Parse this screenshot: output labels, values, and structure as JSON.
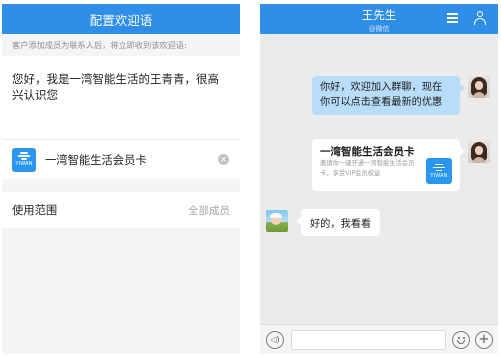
{
  "left_screen": {
    "title": "配置欢迎语",
    "hint": "客户添加成员为联系人后，将立即收到该欢迎语:",
    "message": "您好，我是一湾智能生活的王青青，很高兴认识您",
    "attachment": {
      "logo_text": "YIWAN",
      "name": "一湾智能生活会员卡",
      "icon": "clear-icon"
    },
    "scope": {
      "label": "使用范围",
      "value": "全部成员"
    }
  },
  "right_screen": {
    "title": "王先生",
    "subtitle": "@微信",
    "header_icons": [
      "menu-icon",
      "person-icon"
    ],
    "messages": [
      {
        "sender": "me",
        "type": "text",
        "text": "你好，欢迎加入群聊，现在你可以点击查看最新的优惠"
      },
      {
        "sender": "me",
        "type": "card",
        "title": "一湾智能生活会员卡",
        "description": "邀请你一键开通一湾智能生活会员卡，享受VIP会员权益",
        "logo_text": "YIWAN"
      },
      {
        "sender": "other",
        "type": "text",
        "text": "好的，我看看"
      }
    ],
    "bottom_icons": [
      "voice-icon",
      "emoji-icon",
      "plus-icon"
    ]
  },
  "colors": {
    "header_blue": "#2f8ee8",
    "sent_bubble": "#b8ddf8",
    "logo_blue": "#2a97ee"
  }
}
